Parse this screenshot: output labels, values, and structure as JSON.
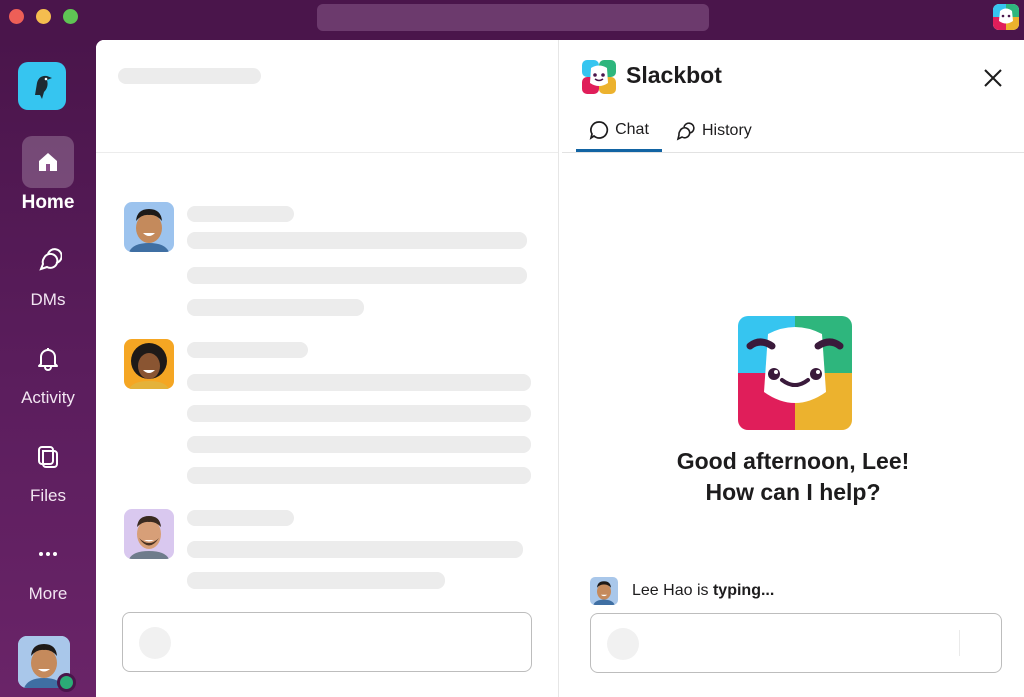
{
  "window": {
    "traffic_lights": [
      "close",
      "minimize",
      "maximize"
    ],
    "colors": {
      "close": "#ee5f57",
      "minimize": "#f5bd4f",
      "maximize": "#5fc454",
      "aubergine": "#4a154b"
    }
  },
  "sidebar": {
    "workspace_icon": "bird-icon",
    "items": [
      {
        "label": "Home",
        "icon": "home-icon",
        "active": true
      },
      {
        "label": "DMs",
        "icon": "dms-icon",
        "active": false
      },
      {
        "label": "Activity",
        "icon": "bell-icon",
        "active": false
      },
      {
        "label": "Files",
        "icon": "files-icon",
        "active": false
      },
      {
        "label": "More",
        "icon": "more-icon",
        "active": false
      }
    ],
    "user_status": "online"
  },
  "slackbot_panel": {
    "title": "Slackbot",
    "tabs": [
      {
        "label": "Chat",
        "icon": "chat-bubble-icon",
        "active": true
      },
      {
        "label": "History",
        "icon": "history-icon",
        "active": false
      }
    ],
    "greeting_line1": "Good afternoon, Lee!",
    "greeting_line2": "How can I help?",
    "typing_name": "Lee Hao",
    "typing_is": "is",
    "typing_word": "typing..."
  }
}
